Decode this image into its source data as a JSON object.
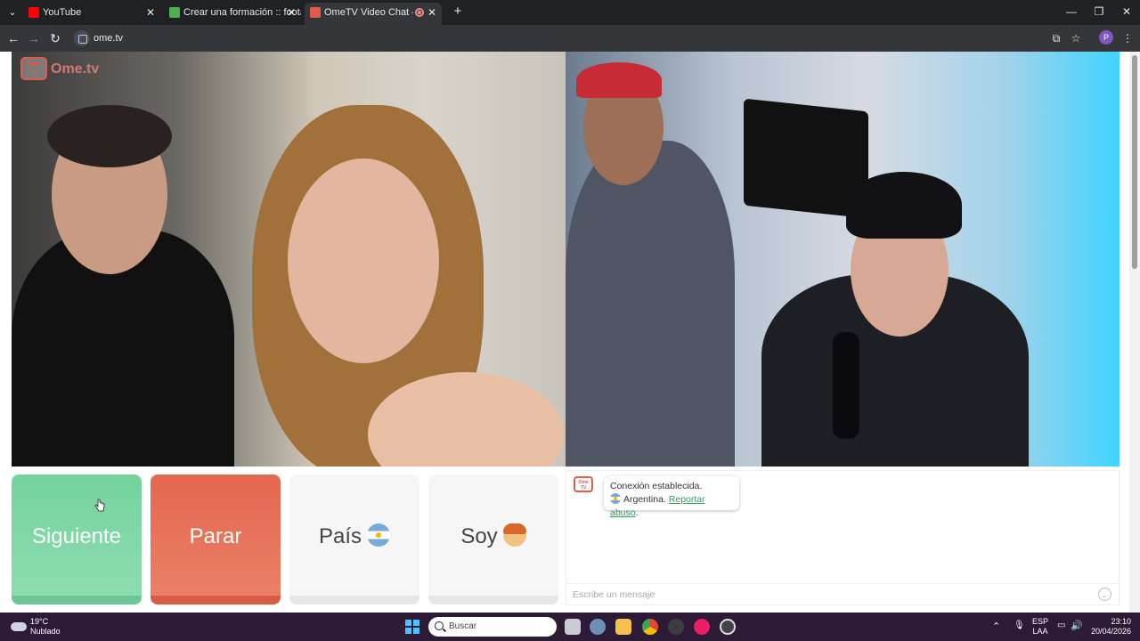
{
  "browser": {
    "tabs": [
      {
        "title": "YouTube",
        "favicon_color": "#ff0000"
      },
      {
        "title": "Crear una formación :: footalist",
        "favicon_color": "#4caf50"
      },
      {
        "title": "OmeTV Video Chat — Omegle",
        "favicon_color": "#e05a4e",
        "recording": true
      }
    ],
    "active_tab": 2,
    "address": "ome.tv",
    "profile_initial": "P"
  },
  "video": {
    "logo_tv": "Ome TV",
    "logo_text": "Ome.tv"
  },
  "controls": {
    "next_label": "Siguiente",
    "stop_label": "Parar",
    "country_label": "País",
    "gender_label": "Soy",
    "next_color": "#7ed8a7",
    "stop_color": "#e5674f"
  },
  "chat": {
    "status_line": "Conexión establecida.",
    "country": "Argentina.",
    "report_link": "Reportar abuso",
    "report_suffix": ".",
    "input_placeholder": "Escribe un mensaje"
  },
  "taskbar": {
    "weather_temp": "19°C",
    "weather_desc": "Nublado",
    "search_placeholder": "Buscar",
    "lang_top": "ESP",
    "lang_bottom": "LAA",
    "time": "23:10",
    "date": "20/04/2026"
  }
}
